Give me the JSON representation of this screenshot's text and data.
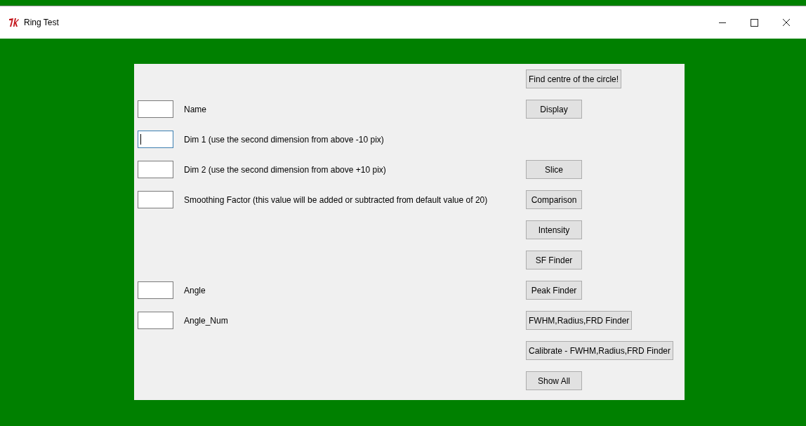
{
  "window": {
    "title": "Ring Test"
  },
  "rows": [
    {
      "button": "Find centre of the circle!"
    },
    {
      "field": {
        "label": "Name",
        "focused": false
      },
      "button": "Display"
    },
    {
      "field": {
        "label": "Dim 1 (use the second dimension from above -10 pix)",
        "focused": true
      }
    },
    {
      "field": {
        "label": "Dim 2 (use the second dimension from above +10 pix)",
        "focused": false
      },
      "button": "Slice"
    },
    {
      "field": {
        "label": "Smoothing Factor (this value will be added or subtracted from default value of 20)",
        "focused": false
      },
      "button": "Comparison"
    },
    {
      "button": "Intensity"
    },
    {
      "button": "SF Finder"
    },
    {
      "field": {
        "label": "Angle",
        "focused": false
      },
      "button": "Peak Finder"
    },
    {
      "field": {
        "label": "Angle_Num",
        "focused": false
      },
      "button": "FWHM,Radius,FRD Finder"
    },
    {
      "button": "Calibrate - FWHM,Radius,FRD Finder"
    },
    {
      "button": "Show All"
    }
  ]
}
